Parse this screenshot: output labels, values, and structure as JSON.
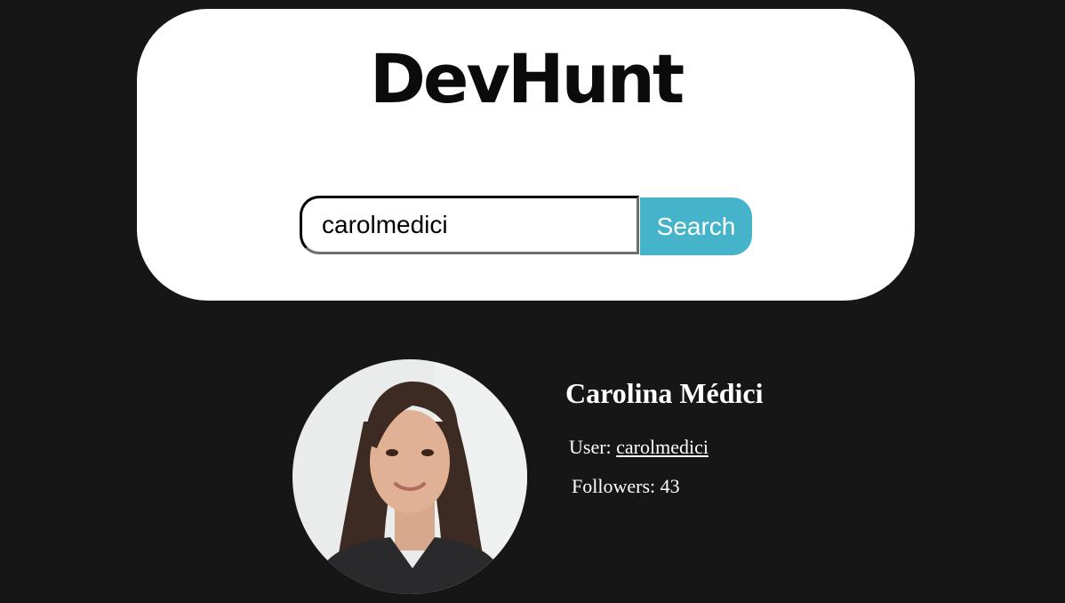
{
  "header": {
    "logo_text": "DevHunt"
  },
  "search": {
    "value": "carolmedici",
    "button_label": "Search"
  },
  "profile": {
    "name": "Carolina Médici",
    "user_label": "User:",
    "username": "carolmedici",
    "followers_label": "Followers:",
    "followers_count": "43"
  },
  "colors": {
    "background": "#161616",
    "card": "#ffffff",
    "accent": "#45b4cb"
  }
}
